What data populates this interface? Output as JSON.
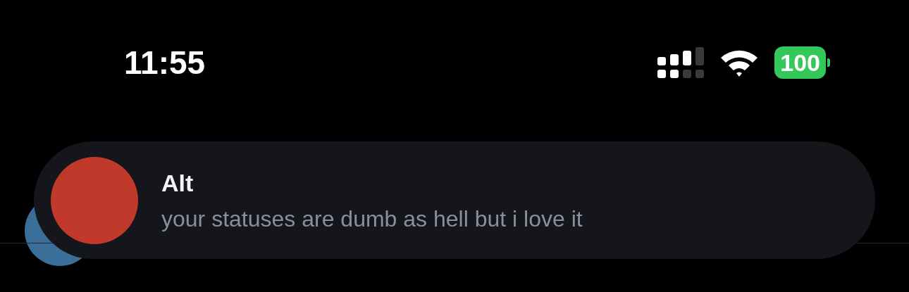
{
  "status_bar": {
    "time": "11:55",
    "battery": "100"
  },
  "notification": {
    "sender": "Alt",
    "message": "your statuses are dumb as hell but i love it"
  }
}
